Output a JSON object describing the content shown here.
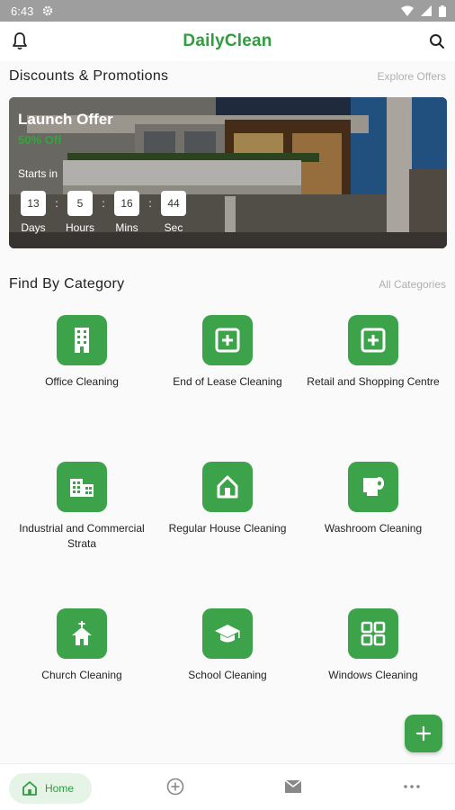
{
  "status_bar": {
    "time": "6:43"
  },
  "app_bar": {
    "title": "DailyClean",
    "left_icon": "bell-icon",
    "right_icon": "search-icon"
  },
  "promotions": {
    "title": "Discounts & Promotions",
    "link": "Explore Offers",
    "banner": {
      "offer_title": "Launch Offer",
      "offer_subtitle": "50% Off",
      "starts_label": "Starts in",
      "countdown": {
        "days": "13",
        "hours": "5",
        "mins": "16",
        "sec": "44",
        "days_label": "Days",
        "hours_label": "Hours",
        "mins_label": "Mins",
        "sec_label": "Sec",
        "separator": ":"
      }
    }
  },
  "categories": {
    "title": "Find By Category",
    "link": "All Categories",
    "items": [
      {
        "label": "Office Cleaning",
        "icon": "office-building-icon"
      },
      {
        "label": "End of Lease Cleaning",
        "icon": "plus-box-icon"
      },
      {
        "label": "Retail and Shopping Centre",
        "icon": "plus-box-icon"
      },
      {
        "label": "Industrial and Commercial Strata",
        "icon": "factory-icon"
      },
      {
        "label": "Regular House Cleaning",
        "icon": "house-icon"
      },
      {
        "label": "Washroom Cleaning",
        "icon": "toilet-paper-icon"
      },
      {
        "label": "Church Cleaning",
        "icon": "church-icon"
      },
      {
        "label": "School Cleaning",
        "icon": "graduation-cap-icon"
      },
      {
        "label": "Windows Cleaning",
        "icon": "window-grid-icon"
      }
    ]
  },
  "fab": {
    "icon": "plus-icon"
  },
  "bottom_nav": {
    "home_label": "Home",
    "items": [
      "home-icon",
      "add-circle-icon",
      "mail-icon",
      "more-icon"
    ]
  },
  "colors": {
    "accent": "#3ca34a",
    "brand_text": "#2e9e3e",
    "status_bar": "#9e9e9e"
  }
}
